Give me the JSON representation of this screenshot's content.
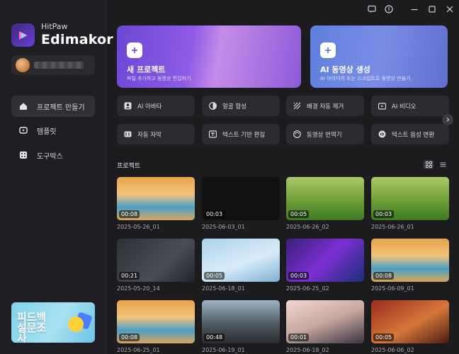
{
  "app": {
    "brand_top": "HitPaw",
    "brand_main": "Edimakor"
  },
  "window_controls": [
    "feedback-icon",
    "help-icon",
    "minimize-icon",
    "maximize-icon",
    "close-icon"
  ],
  "nav": [
    {
      "label": "프로젝트 만들기",
      "icon": "home-icon",
      "active": true
    },
    {
      "label": "템플릿",
      "icon": "template-icon",
      "active": false
    },
    {
      "label": "도구박스",
      "icon": "toolbox-icon",
      "active": false
    }
  ],
  "survey": {
    "label": "피드백 설문조사"
  },
  "hero": {
    "new_project": {
      "title": "새 프로젝트",
      "subtitle": "파일 추가하고 동영상 편집하기"
    },
    "ai_video": {
      "title": "AI 동영상 생성",
      "subtitle": "AI 아이디어 또는 스크립트로 동영상 만들기"
    }
  },
  "tools": [
    {
      "label": "AI 아바타",
      "icon": "avatar-icon"
    },
    {
      "label": "얼굴 합성",
      "icon": "face-swap-icon"
    },
    {
      "label": "배경 자동 제거",
      "icon": "background-remove-icon"
    },
    {
      "label": "AI 비디오",
      "icon": "ai-video-icon"
    },
    {
      "label": "자동 자막",
      "icon": "subtitle-icon"
    },
    {
      "label": "텍스트 기반 편집",
      "icon": "text-edit-icon"
    },
    {
      "label": "동영상 번역기",
      "icon": "translate-icon"
    },
    {
      "label": "텍스트 음성 변환",
      "icon": "tts-icon"
    }
  ],
  "projects_section": {
    "title": "프로젝트"
  },
  "projects": [
    {
      "name": "2025-05-26_01",
      "duration": "00:08",
      "thumb": "t-sky"
    },
    {
      "name": "2025-06-03_01",
      "duration": "00:03",
      "thumb": "t-dark"
    },
    {
      "name": "2025-06-26_02",
      "duration": "00:05",
      "thumb": "t-grass"
    },
    {
      "name": "2025-06-26_01",
      "duration": "00:03",
      "thumb": "t-grass"
    },
    {
      "name": "2025-05-20_14",
      "duration": "00:21",
      "thumb": "t-people"
    },
    {
      "name": "2025-06-18_01",
      "duration": "00:05",
      "thumb": "t-cat"
    },
    {
      "name": "2025-06-25_02",
      "duration": "00:03",
      "thumb": "t-game"
    },
    {
      "name": "2025-06-09_01",
      "duration": "00:08",
      "thumb": "t-sky"
    },
    {
      "name": "2025-06-25_01",
      "duration": "00:08",
      "thumb": "t-sky"
    },
    {
      "name": "2025-06-19_01",
      "duration": "00:48",
      "thumb": "t-monster"
    },
    {
      "name": "2025-06-18_02",
      "duration": "00:01",
      "thumb": "t-anime"
    },
    {
      "name": "2025-06-06_02",
      "duration": "00:05",
      "thumb": "t-books"
    }
  ]
}
